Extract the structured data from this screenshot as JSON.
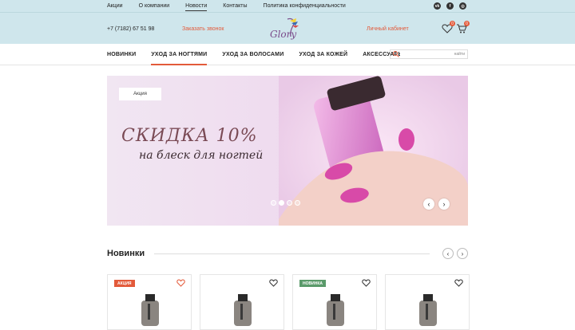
{
  "topbar": {
    "links": [
      "Акции",
      "О компании",
      "Новости",
      "Контакты",
      "Политика конфиденциальности"
    ],
    "active_index": 2,
    "socials": [
      {
        "icon": "vk-icon",
        "glyph": "vk"
      },
      {
        "icon": "facebook-icon",
        "glyph": "f"
      },
      {
        "icon": "instagram-icon",
        "glyph": "◎"
      }
    ]
  },
  "header": {
    "phone": "+7 (7182) 67 51 98",
    "callback": "Заказать звонок",
    "logo_text": "Glory",
    "cabinet": "Личный кабинет",
    "wishlist_count": "0",
    "cart_count": "0"
  },
  "nav": {
    "items": [
      "НОВИНКИ",
      "УХОД ЗА НОГТЯМИ",
      "УХОД ЗА ВОЛОСАМИ",
      "УХОД ЗА КОЖЕЙ",
      "АКСЕССУАРЫ"
    ],
    "active_index": 1,
    "search_placeholder": "",
    "search_button": "найти"
  },
  "hero": {
    "tag": "Акция",
    "title": "СКИДКА 10%",
    "subtitle": "на блеск для ногтей",
    "slide_count": 4,
    "active_slide": 1
  },
  "section": {
    "title": "Новинки"
  },
  "products": [
    {
      "tag": "АКЦИЯ",
      "tag_type": "sale",
      "liked": true
    },
    {
      "tag": "",
      "tag_type": "",
      "liked": false
    },
    {
      "tag": "НОВИНКА",
      "tag_type": "new",
      "liked": false
    },
    {
      "tag": "",
      "tag_type": "",
      "liked": false
    }
  ],
  "colors": {
    "accent": "#e35a3a",
    "header_bg": "#cfe6ec",
    "new_badge": "#5a9a6a"
  }
}
